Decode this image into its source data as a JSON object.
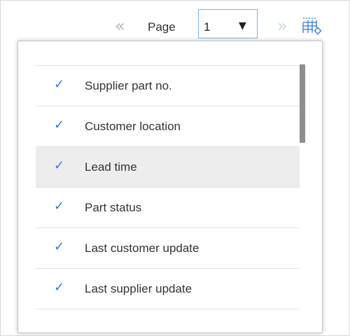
{
  "pager": {
    "prev_glyph": "«",
    "label": "Page",
    "current_page": "1",
    "caret": "▼",
    "next_glyph": "»"
  },
  "column_menu": {
    "check_glyph": "✓",
    "items": [
      {
        "label": "Supplier part no.",
        "checked": true
      },
      {
        "label": "Customer location",
        "checked": true
      },
      {
        "label": "Lead time",
        "checked": true,
        "hovered": true
      },
      {
        "label": "Part status",
        "checked": true
      },
      {
        "label": "Last customer update",
        "checked": true
      },
      {
        "label": "Last supplier update",
        "checked": true
      }
    ]
  },
  "colors": {
    "accent": "#2f7bd6",
    "select_border": "#7fb2e3",
    "hover_row": "#ededed",
    "scroll_thumb": "#8e8e8e"
  },
  "icons": {
    "table_settings": "table-settings-icon"
  }
}
